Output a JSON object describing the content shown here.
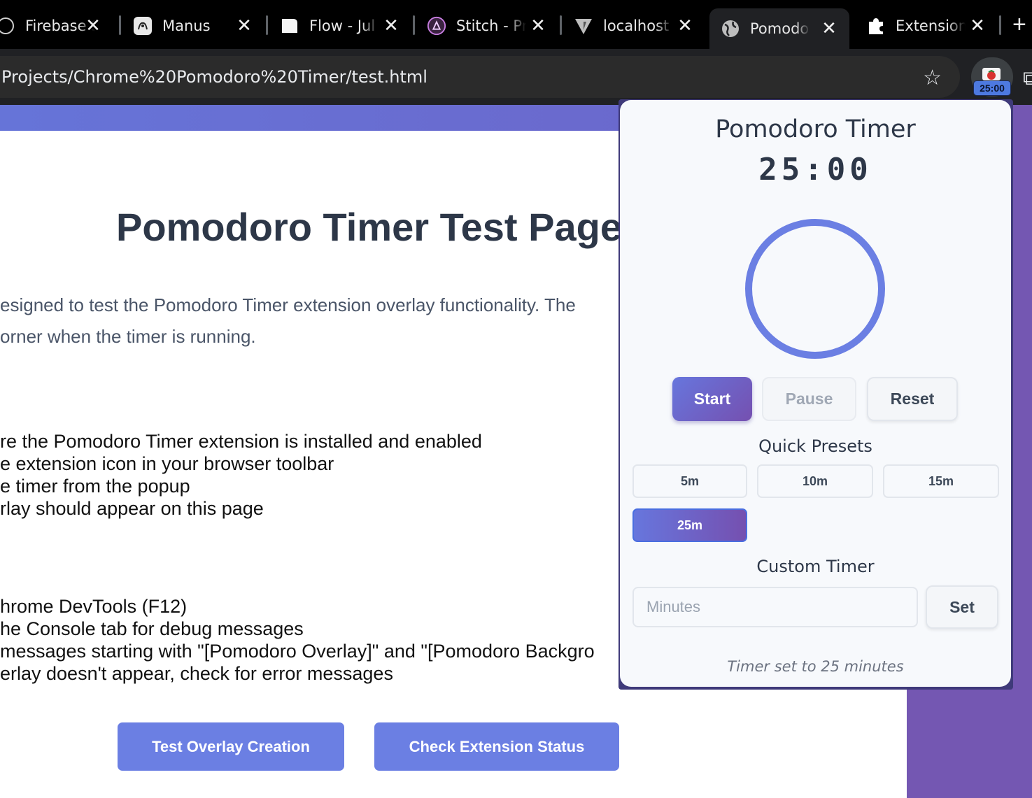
{
  "tabs": [
    {
      "title": "Firebase S",
      "icon": "firebase-icon"
    },
    {
      "title": "Manus",
      "icon": "manus-icon"
    },
    {
      "title": "Flow - Jul",
      "icon": "flow-icon"
    },
    {
      "title": "Stitch - Pr",
      "icon": "stitch-icon"
    },
    {
      "title": "localhost",
      "icon": "vite-icon"
    },
    {
      "title": "Pomodor",
      "icon": "globe-icon",
      "active": true
    },
    {
      "title": "Extension",
      "icon": "puzzle-icon"
    }
  ],
  "tab_close_glyph": "✕",
  "new_tab_glyph": "+",
  "address": {
    "url": "Projects/Chrome%20Pomodoro%20Timer/test.html",
    "bookmark_glyph": "☆"
  },
  "extension": {
    "badge": "25:00",
    "icon": "tomato-icon"
  },
  "page": {
    "title": "Pomodoro Timer Test Page",
    "intro_lines": [
      "esigned to test the Pomodoro Timer extension overlay functionality. The",
      "orner when the timer is running."
    ],
    "steps": [
      "re the Pomodoro Timer extension is installed and enabled",
      "e extension icon in your browser toolbar",
      "e timer from the popup",
      "rlay should appear on this page"
    ],
    "debug": [
      "hrome DevTools (F12)",
      "he Console tab for debug messages",
      " messages starting with \"[Pomodoro Overlay]\" and \"[Pomodoro Backgro",
      "erlay doesn't appear, check for error messages"
    ],
    "buttons": {
      "test_overlay": "Test Overlay Creation",
      "check_status": "Check Extension Status"
    }
  },
  "popup": {
    "title": "Pomodoro Timer",
    "time": "25:00",
    "progress": 0,
    "controls": {
      "start": "Start",
      "pause": "Pause",
      "reset": "Reset"
    },
    "presets_heading": "Quick Presets",
    "presets": [
      "5m",
      "10m",
      "15m",
      "25m"
    ],
    "active_preset": "25m",
    "custom_heading": "Custom Timer",
    "custom_placeholder": "Minutes",
    "set_label": "Set",
    "status": "Timer set to 25 minutes",
    "colors": {
      "accent": "#667eea",
      "accent_end": "#764ba2",
      "ring": "#6b7fe3"
    }
  }
}
